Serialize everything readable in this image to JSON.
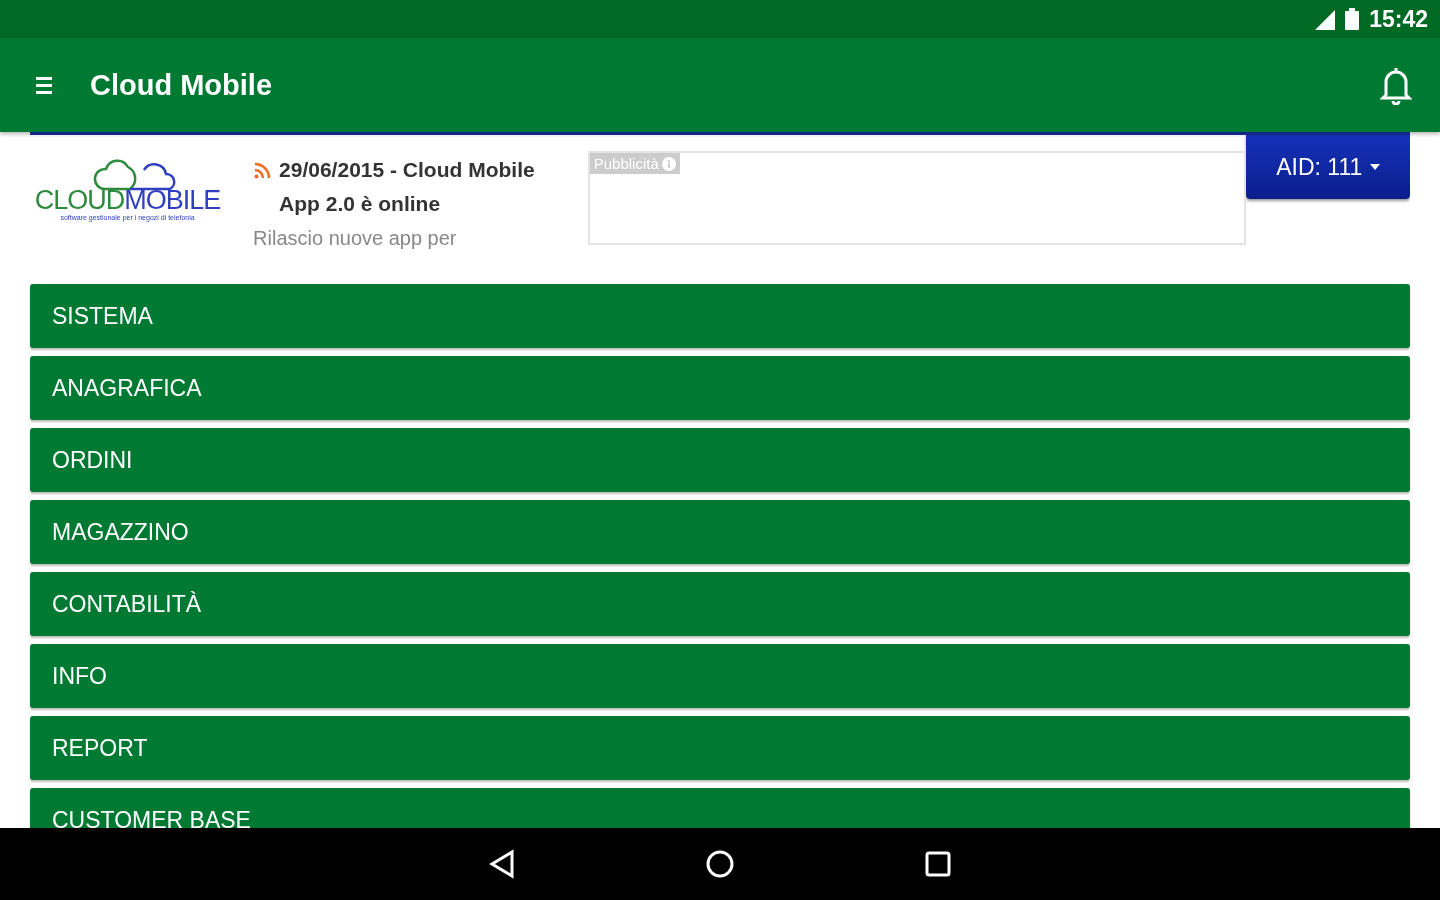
{
  "status_bar": {
    "time": "15:42"
  },
  "app_bar": {
    "title": "Cloud Mobile"
  },
  "logo": {
    "word_1": "CLOUD",
    "word_2": "MOBILE",
    "tagline": "software gestionale per i negozi di telefonia"
  },
  "news": {
    "title": "29/06/2015 - Cloud Mobile App 2.0 è online",
    "summary": "Rilascio nuove app per"
  },
  "ad": {
    "label": "Pubblicità"
  },
  "account_button": {
    "label": "AID: 111"
  },
  "menu": [
    {
      "label": "SISTEMA"
    },
    {
      "label": "ANAGRAFICA"
    },
    {
      "label": "ORDINI"
    },
    {
      "label": "MAGAZZINO"
    },
    {
      "label": "CONTABILITÀ"
    },
    {
      "label": "INFO"
    },
    {
      "label": "REPORT"
    },
    {
      "label": "CUSTOMER BASE"
    }
  ]
}
